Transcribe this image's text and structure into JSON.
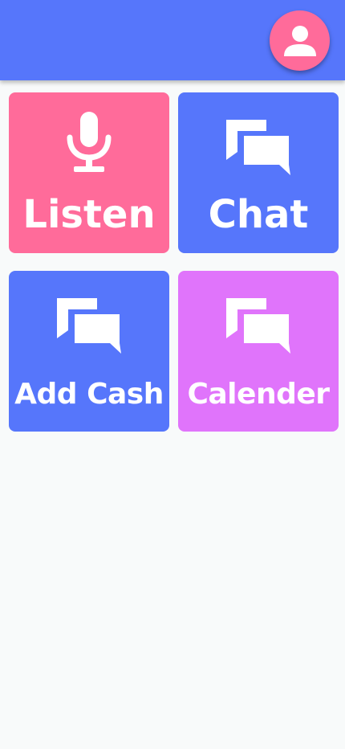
{
  "header": {
    "background": "#5676fb",
    "avatar_icon": "person-icon",
    "avatar_color": "#ff6b9a"
  },
  "tiles": [
    {
      "label": "Listen",
      "icon": "microphone-icon",
      "color": "#ff6b9a"
    },
    {
      "label": "Chat",
      "icon": "chat-icon",
      "color": "#5676fb"
    },
    {
      "label": "Add Cash",
      "icon": "chat-icon",
      "color": "#5676fb"
    },
    {
      "label": "Calender",
      "icon": "chat-icon",
      "color": "#e074fb"
    }
  ],
  "page_background": "#f8fafa"
}
